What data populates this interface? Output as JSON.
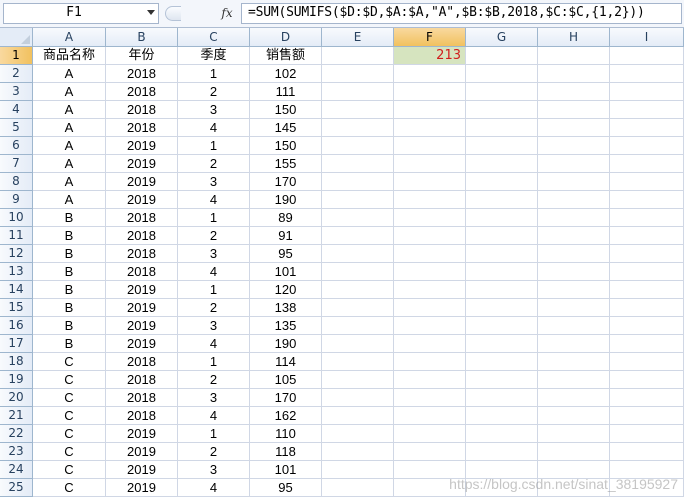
{
  "formula_bar": {
    "name_box": "F1",
    "fx_label": "fx",
    "formula": "=SUM(SUMIFS($D:$D,$A:$A,\"A\",$B:$B,2018,$C:$C,{1,2}))"
  },
  "columns": [
    "A",
    "B",
    "C",
    "D",
    "E",
    "F",
    "G",
    "H",
    "I"
  ],
  "active_cell": {
    "column": "F",
    "row": 1
  },
  "rows": [
    {
      "n": "1",
      "a": "商品名称",
      "b": "年份",
      "c": "季度",
      "d": "销售额",
      "f": "213"
    },
    {
      "n": "2",
      "a": "A",
      "b": "2018",
      "c": "1",
      "d": "102"
    },
    {
      "n": "3",
      "a": "A",
      "b": "2018",
      "c": "2",
      "d": "111"
    },
    {
      "n": "4",
      "a": "A",
      "b": "2018",
      "c": "3",
      "d": "150"
    },
    {
      "n": "5",
      "a": "A",
      "b": "2018",
      "c": "4",
      "d": "145"
    },
    {
      "n": "6",
      "a": "A",
      "b": "2019",
      "c": "1",
      "d": "150"
    },
    {
      "n": "7",
      "a": "A",
      "b": "2019",
      "c": "2",
      "d": "155"
    },
    {
      "n": "8",
      "a": "A",
      "b": "2019",
      "c": "3",
      "d": "170"
    },
    {
      "n": "9",
      "a": "A",
      "b": "2019",
      "c": "4",
      "d": "190"
    },
    {
      "n": "10",
      "a": "B",
      "b": "2018",
      "c": "1",
      "d": "89"
    },
    {
      "n": "11",
      "a": "B",
      "b": "2018",
      "c": "2",
      "d": "91"
    },
    {
      "n": "12",
      "a": "B",
      "b": "2018",
      "c": "3",
      "d": "95"
    },
    {
      "n": "13",
      "a": "B",
      "b": "2018",
      "c": "4",
      "d": "101"
    },
    {
      "n": "14",
      "a": "B",
      "b": "2019",
      "c": "1",
      "d": "120"
    },
    {
      "n": "15",
      "a": "B",
      "b": "2019",
      "c": "2",
      "d": "138"
    },
    {
      "n": "16",
      "a": "B",
      "b": "2019",
      "c": "3",
      "d": "135"
    },
    {
      "n": "17",
      "a": "B",
      "b": "2019",
      "c": "4",
      "d": "190"
    },
    {
      "n": "18",
      "a": "C",
      "b": "2018",
      "c": "1",
      "d": "114"
    },
    {
      "n": "19",
      "a": "C",
      "b": "2018",
      "c": "2",
      "d": "105"
    },
    {
      "n": "20",
      "a": "C",
      "b": "2018",
      "c": "3",
      "d": "170"
    },
    {
      "n": "21",
      "a": "C",
      "b": "2018",
      "c": "4",
      "d": "162"
    },
    {
      "n": "22",
      "a": "C",
      "b": "2019",
      "c": "1",
      "d": "110"
    },
    {
      "n": "23",
      "a": "C",
      "b": "2019",
      "c": "2",
      "d": "118"
    },
    {
      "n": "24",
      "a": "C",
      "b": "2019",
      "c": "3",
      "d": "101"
    },
    {
      "n": "25",
      "a": "C",
      "b": "2019",
      "c": "4",
      "d": "95"
    }
  ],
  "watermark": "https://blog.csdn.net/sinat_38195927",
  "colors": {
    "selected_cell_bg": "#d6e4bf",
    "selected_cell_text": "#d11c1c",
    "header_active": "#f1c15f"
  }
}
